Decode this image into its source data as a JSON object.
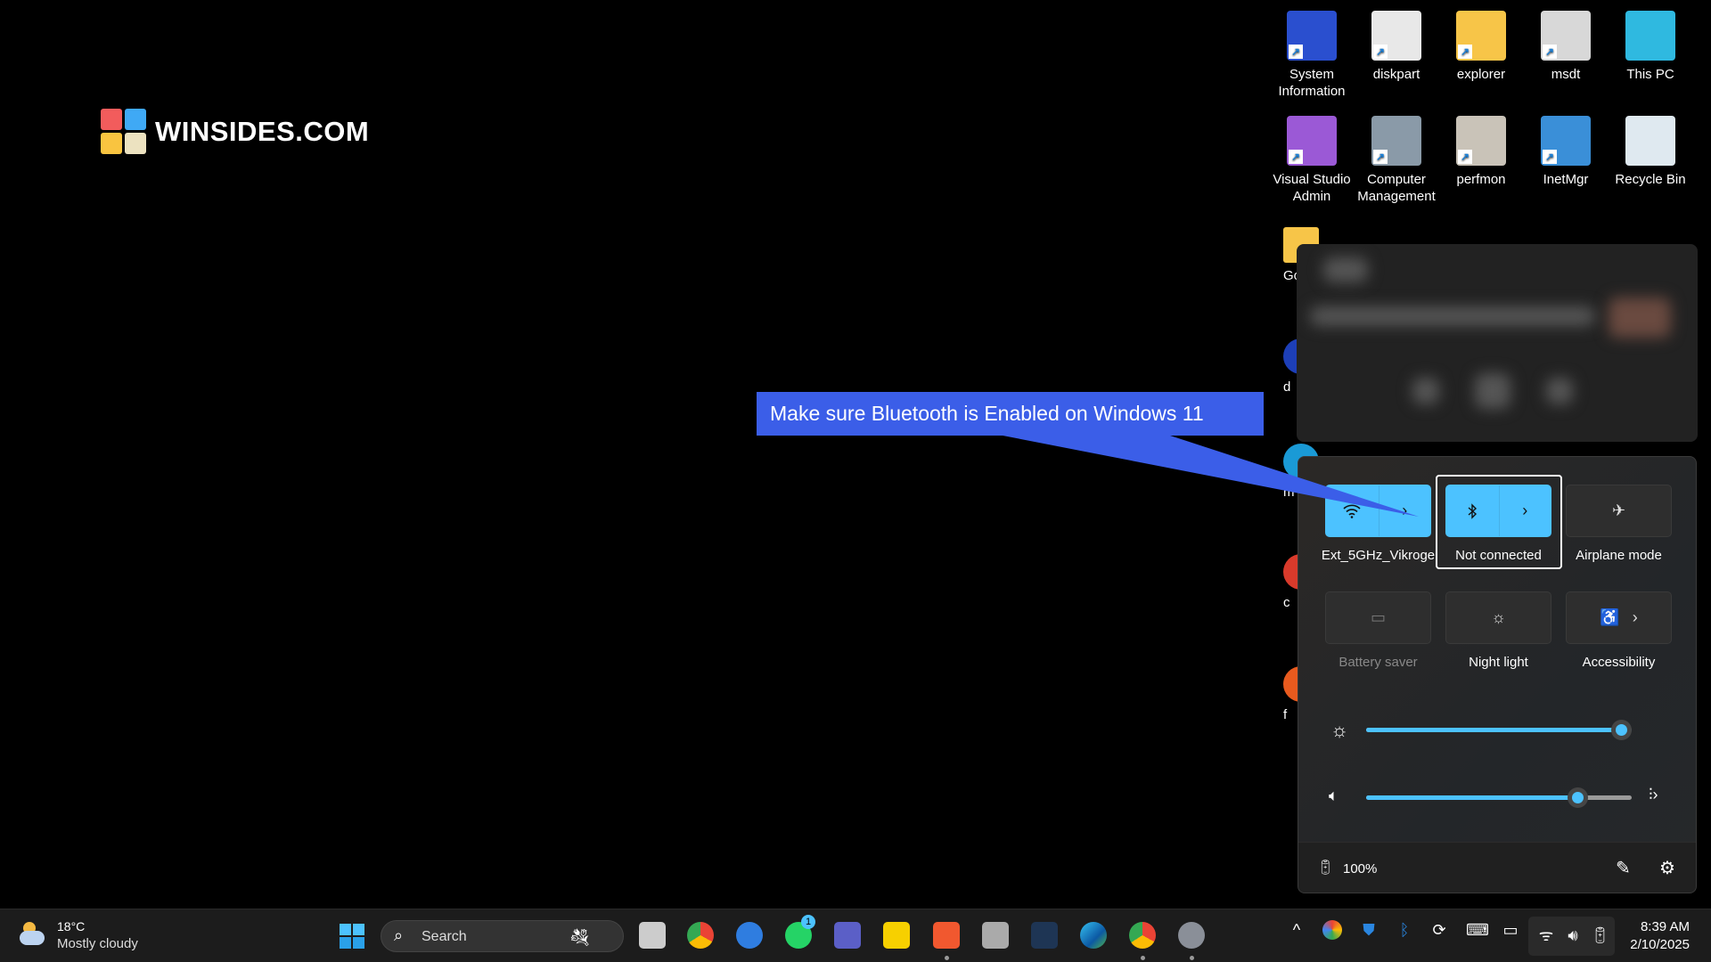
{
  "logo": {
    "text": "WINSIDES.COM",
    "colors": [
      "#f25c5c",
      "#3fa9f5",
      "#f9c440",
      "#ece2c0"
    ]
  },
  "desktop_icons": [
    {
      "label": "System Information",
      "icon": "system-info-icon",
      "color": "#2a4fcf"
    },
    {
      "label": "diskpart",
      "icon": "diskpart-icon",
      "color": "#e8e8e8"
    },
    {
      "label": "explorer",
      "icon": "folder-icon",
      "color": "#f7c548"
    },
    {
      "label": "msdt",
      "icon": "msdt-icon",
      "color": "#d8d8d8"
    },
    {
      "label": "This PC",
      "icon": "monitor-icon",
      "color": "#2fb9e0"
    },
    {
      "label": "Visual Studio Admin",
      "icon": "visual-studio-icon",
      "color": "#9b59d6"
    },
    {
      "label": "Computer Management",
      "icon": "computer-management-icon",
      "color": "#8a9aa8"
    },
    {
      "label": "perfmon",
      "icon": "perfmon-icon",
      "color": "#c9c3b8"
    },
    {
      "label": "InetMgr",
      "icon": "globe-server-icon",
      "color": "#3a8fd8"
    },
    {
      "label": "Recycle Bin",
      "icon": "recycle-bin-icon",
      "color": "#dfe9f0"
    }
  ],
  "partial_icons": [
    {
      "label": "Go"
    },
    {
      "label": "d"
    },
    {
      "label": "m"
    },
    {
      "label": "c"
    },
    {
      "label": "f"
    }
  ],
  "callout": {
    "text": "Make sure Bluetooth is Enabled on Windows 11",
    "color": "#3b5ee8"
  },
  "quick_settings": {
    "tiles": [
      {
        "label": "Ext_5GHz_Vikroge",
        "icon": "wifi-icon",
        "on": true,
        "chevron": true
      },
      {
        "label": "Not connected",
        "icon": "bluetooth-icon",
        "on": true,
        "chevron": true
      },
      {
        "label": "Airplane mode",
        "icon": "airplane-icon",
        "on": false
      },
      {
        "label": "Battery saver",
        "icon": "battery-saver-icon",
        "on": false,
        "disabled": true
      },
      {
        "label": "Night light",
        "icon": "night-light-icon",
        "on": false
      },
      {
        "label": "Accessibility",
        "icon": "accessibility-icon",
        "on": false,
        "chevron": true
      }
    ],
    "brightness_percent": 100,
    "volume_percent": 83,
    "battery": "100%",
    "accent": "#4cc2ff"
  },
  "taskbar": {
    "weather": {
      "temp": "18°C",
      "condition": "Mostly cloudy"
    },
    "search_placeholder": "Search",
    "whatsapp_badge": "1",
    "clock": {
      "time": "8:39 AM",
      "date": "2/10/2025"
    }
  }
}
